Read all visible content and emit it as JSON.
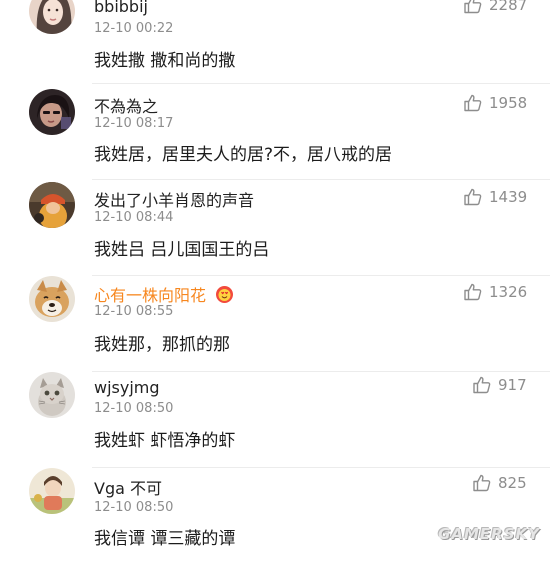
{
  "comments": [
    {
      "username": "bbibbij",
      "time": "12-10 00:22",
      "text": "我姓撒 撒和尚的撒",
      "likes": "2287",
      "avatar": "avatar-woman-portrait"
    },
    {
      "username": "不為為之",
      "time": "12-10 08:17",
      "text": "我姓居，居里夫人的居?不，居八戒的居",
      "likes": "1958",
      "avatar": "avatar-dark-portrait"
    },
    {
      "username": "发出了小羊肖恩的声音",
      "time": "12-10 08:44",
      "text": "我姓吕 吕儿国国王的吕",
      "likes": "1439",
      "avatar": "avatar-orange-hat"
    },
    {
      "username": "心有一株向阳花",
      "time": "12-10 08:55",
      "text": "我姓那，那抓的那",
      "likes": "1326",
      "avatar": "avatar-shiba-dog",
      "vip": true
    },
    {
      "username": "wjsyjmg",
      "time": "12-10 08:50",
      "text": "我姓虾 虾悟净的虾",
      "likes": "917",
      "avatar": "avatar-cat"
    },
    {
      "username": "Vga 不可",
      "time": "12-10 08:50",
      "text": "我信谭 谭三藏的谭",
      "likes": "825",
      "avatar": "avatar-illustration"
    }
  ],
  "watermark": "GAMERSKY",
  "colors": {
    "vip_name": "#f7871f",
    "meta_gray": "#8d8d8d",
    "badge_red": "#f24a3c"
  }
}
